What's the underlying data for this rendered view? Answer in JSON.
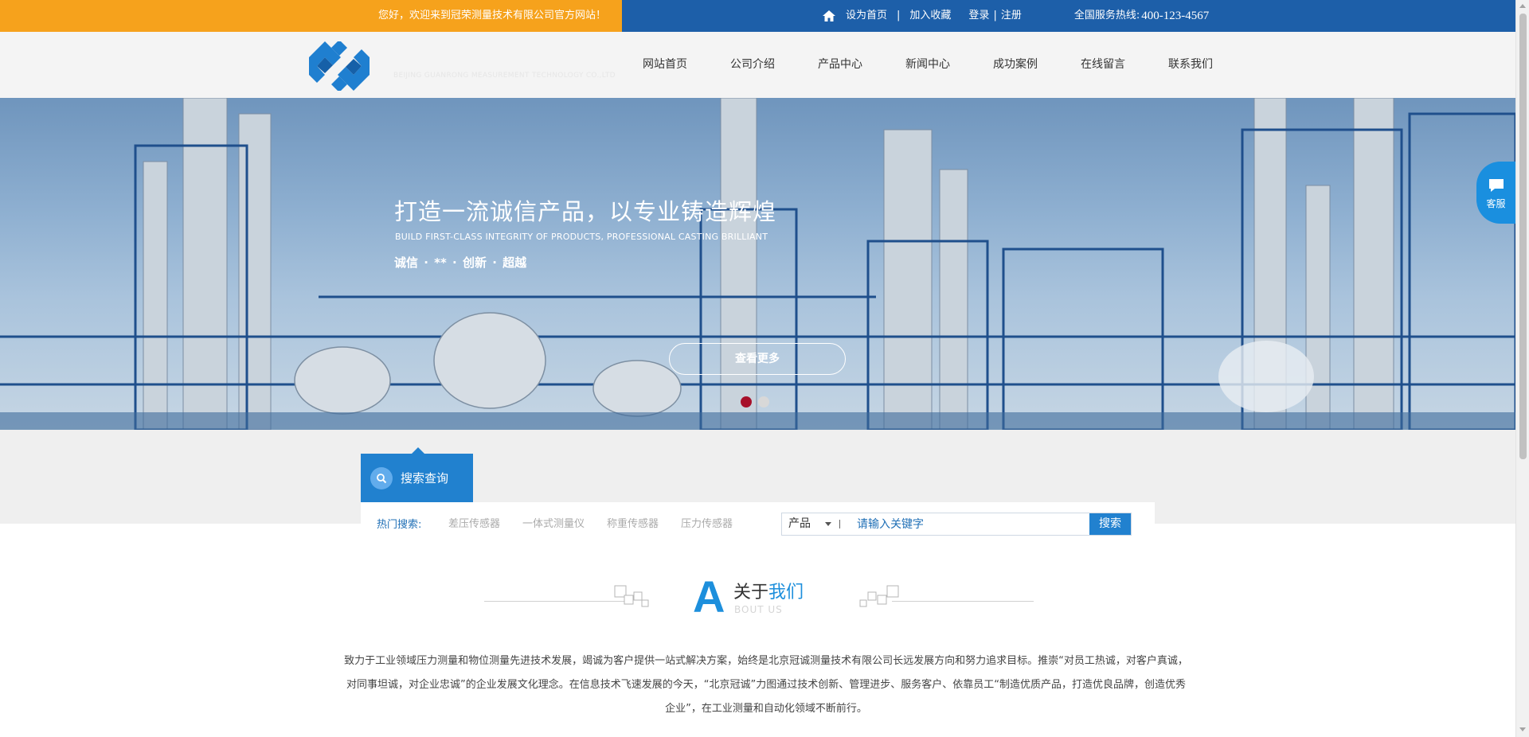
{
  "topbar": {
    "welcome": "您好，欢迎来到冠荣测量技术有限公司官方网站！",
    "set_home": "设为首页",
    "separator": "|",
    "add_favorite": "加入收藏",
    "login": "登录",
    "register": "注册",
    "hotline_label": "全国服务热线:",
    "hotline_number": "400-123-4567"
  },
  "header": {
    "logo_tagline": "BEIJING GUANRONG MEASUREMENT TECHNOLOGY CO.,LTD",
    "nav": [
      "网站首页",
      "公司介绍",
      "产品中心",
      "新闻中心",
      "成功案例",
      "在线留言",
      "联系我们"
    ]
  },
  "banner": {
    "title": "打造一流诚信产品，以专业铸造辉煌",
    "subtitle": "BUILD FIRST-CLASS INTEGRITY OF PRODUCTS, PROFESSIONAL CASTING BRILLIANT",
    "values": "诚信 · ** · 创新 · 超越",
    "more_button": "查看更多",
    "active_slide": 1,
    "slide_count": 2
  },
  "service": {
    "label": "客服"
  },
  "search": {
    "tab_label": "搜索查询",
    "hot_label": "热门搜索:",
    "hot_items": [
      "差压传感器",
      "一体式测量仪",
      "称重传感器",
      "压力传感器"
    ],
    "category": "产品",
    "placeholder": "请输入关键字",
    "button": "搜索"
  },
  "about": {
    "big_letter": "A",
    "title_part1": "关于",
    "title_part2": "我们",
    "subtitle_en": "BOUT US",
    "paragraph": "致力于工业领域压力测量和物位测量先进技术发展，竭诚为客户提供一站式解决方案，始终是北京冠诚测量技术有限公司长远发展方向和努力追求目标。推崇“对员工热诚，对客户真诚，对同事坦诚，对企业忠诚”的企业发展文化理念。在信息技术飞速发展的今天，“北京冠诚”力图通过技术创新、管理进步、服务客户、依靠员工“制造优质产品，打造优良品牌，创造优秀企业”，在工业测量和自动化领域不断前行。"
  },
  "colors": {
    "topbar_blue": "#1d5fa9",
    "welcome_orange": "#f6a21c",
    "accent_blue": "#2181cf",
    "dot_active": "#a7102a"
  }
}
